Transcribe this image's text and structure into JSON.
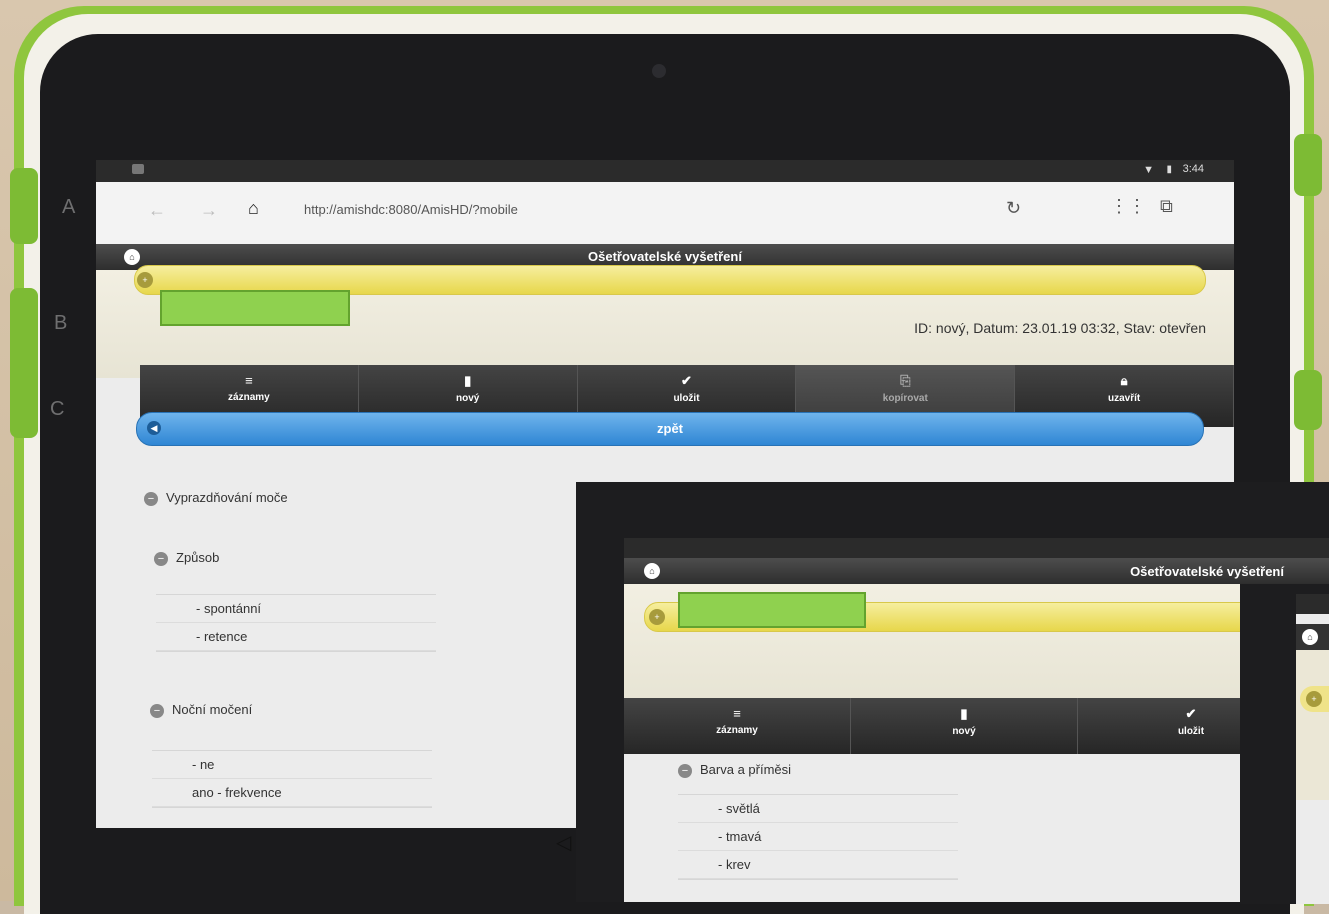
{
  "browser": {
    "url": "http://amishdc:8080/AmisHD/?mobile",
    "status_time": "3:44"
  },
  "device": {
    "side_letters": [
      "A",
      "B",
      "C"
    ]
  },
  "page": {
    "title": "Ošetřovatelské vyšetření",
    "record_info": "ID: nový, Datum: 23.01.19 03:32, Stav: otevřen"
  },
  "toolbar": {
    "items": [
      {
        "label": "záznamy",
        "icon": "list-icon",
        "enabled": true
      },
      {
        "label": "nový",
        "icon": "document-icon",
        "enabled": true
      },
      {
        "label": "uložit",
        "icon": "check-icon",
        "enabled": true
      },
      {
        "label": "kopírovat",
        "icon": "copy-icon",
        "enabled": false
      },
      {
        "label": "uzavřít",
        "icon": "lock-icon",
        "enabled": true
      }
    ]
  },
  "back_button": {
    "label": "zpět"
  },
  "tree": {
    "section": "Vyprazdňování moče",
    "groups": [
      {
        "label": "Způsob",
        "options": [
          "- spontánní",
          "- retence"
        ]
      },
      {
        "label": "Noční močení",
        "options": [
          "- ne",
          "ano - frekvence"
        ]
      }
    ]
  },
  "overlay2": {
    "title": "Ošetřovatelské vyšetření",
    "toolbar": [
      "záznamy",
      "nový",
      "uložit"
    ],
    "group": "Barva a příměsi",
    "options": [
      "- světlá",
      "- tmavá",
      "- krev"
    ]
  }
}
